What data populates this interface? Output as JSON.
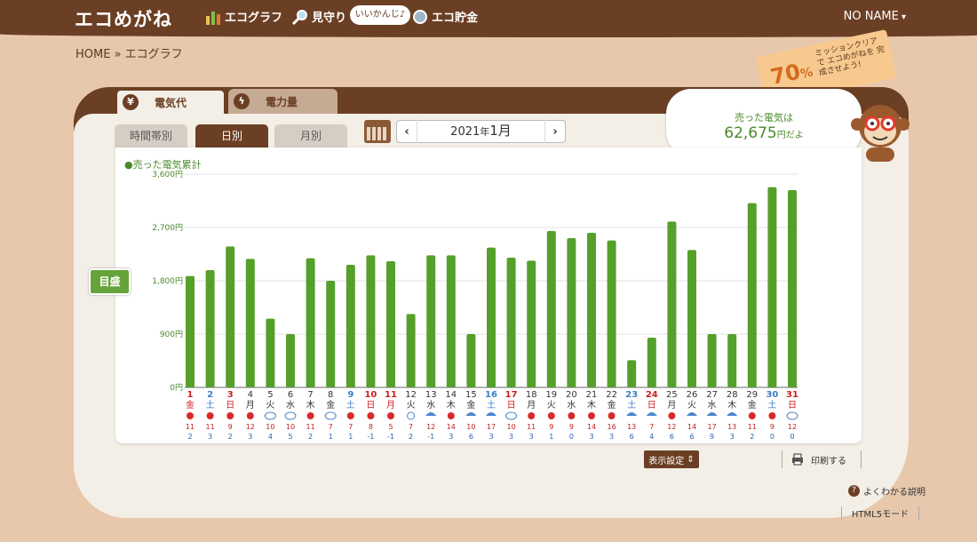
{
  "header": {
    "logo": "エコめがね",
    "nav": [
      {
        "label": "エコグラフ",
        "icon": "bar-chart-icon"
      },
      {
        "label": "見守り",
        "icon": "magnifier-icon"
      },
      {
        "label": "エコ貯金",
        "icon": "coin-icon"
      }
    ],
    "bubble": "いいかんじ♪",
    "user": "NO NAME"
  },
  "breadcrumb": "HOME » エコグラフ",
  "category_tabs": [
    "電気代",
    "電力量"
  ],
  "sub_tabs": [
    "時間帯別",
    "日別",
    "月別"
  ],
  "month": {
    "year": "2021",
    "year_unit": "年",
    "month": "1月"
  },
  "summary": {
    "label": "売った電気は",
    "value": "62,675",
    "unit": "円だよ"
  },
  "mission": {
    "percent": "70",
    "pct_sign": "%",
    "text": "ミッションクリアで エコめがねを 完成させよう!"
  },
  "legend": "●売った電気累計",
  "mebori_button": "目盛",
  "display_settings": "表示設定",
  "print": "印刷する",
  "help": "よくわかる説明",
  "html5_mode": "HTML5モード",
  "colors": {
    "bar": "#55a02b",
    "brown": "#6b3f24",
    "sat": "#3b7ec9",
    "sun": "#cc1f1f",
    "weekday": "#333333"
  },
  "chart_data": {
    "type": "bar",
    "ylim": [
      0,
      3600
    ],
    "yticks": [
      "0円",
      "900円",
      "1,800円",
      "2,700円",
      "3,600円"
    ],
    "ytick_values": [
      0,
      900,
      1800,
      2700,
      3600
    ],
    "categories": [
      "1",
      "2",
      "3",
      "4",
      "5",
      "6",
      "7",
      "8",
      "9",
      "10",
      "11",
      "12",
      "13",
      "14",
      "15",
      "16",
      "17",
      "18",
      "19",
      "20",
      "21",
      "22",
      "23",
      "24",
      "25",
      "26",
      "27",
      "28",
      "29",
      "30",
      "31"
    ],
    "weekdays": [
      "金",
      "土",
      "日",
      "月",
      "火",
      "水",
      "木",
      "金",
      "土",
      "日",
      "月",
      "火",
      "水",
      "木",
      "金",
      "土",
      "日",
      "月",
      "火",
      "水",
      "木",
      "金",
      "土",
      "日",
      "月",
      "火",
      "水",
      "木",
      "金",
      "土",
      "日"
    ],
    "day_types": [
      "hol",
      "sat",
      "hol",
      "wd",
      "wd",
      "wd",
      "wd",
      "wd",
      "sat",
      "hol",
      "hol",
      "wd",
      "wd",
      "wd",
      "wd",
      "sat",
      "hol",
      "wd",
      "wd",
      "wd",
      "wd",
      "wd",
      "sat",
      "hol",
      "wd",
      "wd",
      "wd",
      "wd",
      "wd",
      "sat",
      "hol"
    ],
    "values": [
      1880,
      1980,
      2380,
      2170,
      1160,
      900,
      2180,
      1800,
      2070,
      2230,
      2130,
      1240,
      2230,
      2230,
      900,
      2360,
      2190,
      2140,
      2640,
      2520,
      2610,
      2480,
      460,
      840,
      2800,
      2320,
      900,
      900,
      3110,
      3380,
      3330
    ],
    "weather": [
      "sunny",
      "sunny",
      "sunny",
      "sunny",
      "cloudy",
      "cloudy",
      "sunny",
      "cloudy",
      "sunny",
      "sunny",
      "sunny",
      "snow",
      "rain",
      "sunny",
      "rain",
      "rain",
      "cloudy",
      "sunny",
      "sunny",
      "sunny",
      "sunny",
      "sunny",
      "rain",
      "rain",
      "sunny",
      "rain",
      "rain",
      "rain",
      "sunny",
      "sunny",
      "cloudy"
    ],
    "high_temps": [
      "11",
      "11",
      "9",
      "12",
      "10",
      "10",
      "11",
      "7",
      "7",
      "8",
      "5",
      "7",
      "12",
      "14",
      "10",
      "17",
      "10",
      "11",
      "9",
      "9",
      "14",
      "16",
      "13",
      "7",
      "12",
      "14",
      "17",
      "13",
      "11",
      "9",
      "12"
    ],
    "low_temps": [
      "2",
      "3",
      "2",
      "3",
      "4",
      "5",
      "2",
      "1",
      "1",
      "-1",
      "-1",
      "2",
      "-1",
      "3",
      "6",
      "3",
      "3",
      "3",
      "1",
      "0",
      "3",
      "3",
      "6",
      "4",
      "6",
      "6",
      "9",
      "3",
      "2",
      "0",
      "0"
    ]
  }
}
